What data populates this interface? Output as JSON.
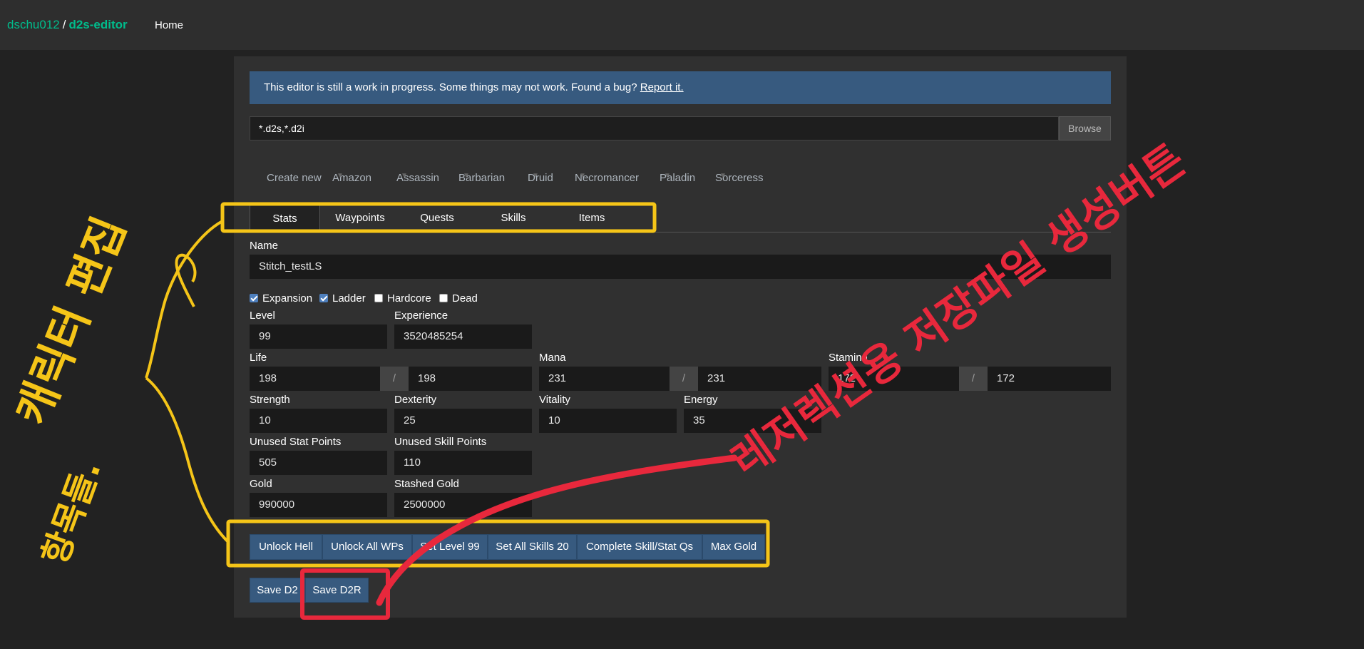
{
  "navbar": {
    "owner": "dschu012",
    "separator": "/",
    "repo": "d2s-editor",
    "home_label": "Home"
  },
  "alert": {
    "message": "This editor is still a work in progress. Some things may not work. Found a bug?",
    "link_label": "Report it."
  },
  "file": {
    "placeholder": "*.d2s,*.d2i",
    "browse_label": "Browse"
  },
  "class_menu": [
    "Create new",
    "Amazon",
    "Assassin",
    "Barbarian",
    "Druid",
    "Necromancer",
    "Paladin",
    "Sorceress"
  ],
  "tabs": [
    "Stats",
    "Waypoints",
    "Quests",
    "Skills",
    "Items"
  ],
  "active_tab": "Stats",
  "character": {
    "name_label": "Name",
    "name": "Stitch_testLS",
    "flags": [
      {
        "label": "Expansion",
        "checked": true
      },
      {
        "label": "Ladder",
        "checked": true
      },
      {
        "label": "Hardcore",
        "checked": false
      },
      {
        "label": "Dead",
        "checked": false
      }
    ],
    "level_label": "Level",
    "level": "99",
    "experience_label": "Experience",
    "experience": "3520485254",
    "life_label": "Life",
    "life_current": "198",
    "life_max": "198",
    "mana_label": "Mana",
    "mana_current": "231",
    "mana_max": "231",
    "stamina_label": "Stamina",
    "stamina_current": "172",
    "stamina_max": "172",
    "slash": "/",
    "strength_label": "Strength",
    "strength": "10",
    "dexterity_label": "Dexterity",
    "dexterity": "25",
    "vitality_label": "Vitality",
    "vitality": "10",
    "energy_label": "Energy",
    "energy": "35",
    "unused_stat_label": "Unused Stat Points",
    "unused_stat": "505",
    "unused_skill_label": "Unused Skill Points",
    "unused_skill": "110",
    "gold_label": "Gold",
    "gold": "990000",
    "stashed_gold_label": "Stashed Gold",
    "stashed_gold": "2500000"
  },
  "quick_actions": [
    "Unlock Hell",
    "Unlock All WPs",
    "Set Level 99",
    "Set All Skills 20",
    "Complete Skill/Stat Qs",
    "Max Gold"
  ],
  "save_buttons": [
    "Save D2",
    "Save D2R"
  ],
  "annotations": {
    "yellow_text_1": "캐릭터 편집",
    "yellow_text_2": "항목들.",
    "red_text": "레저렉션용 저장파일 생성버튼",
    "yellow_color": "#f5c518",
    "red_color": "#e8283c"
  }
}
